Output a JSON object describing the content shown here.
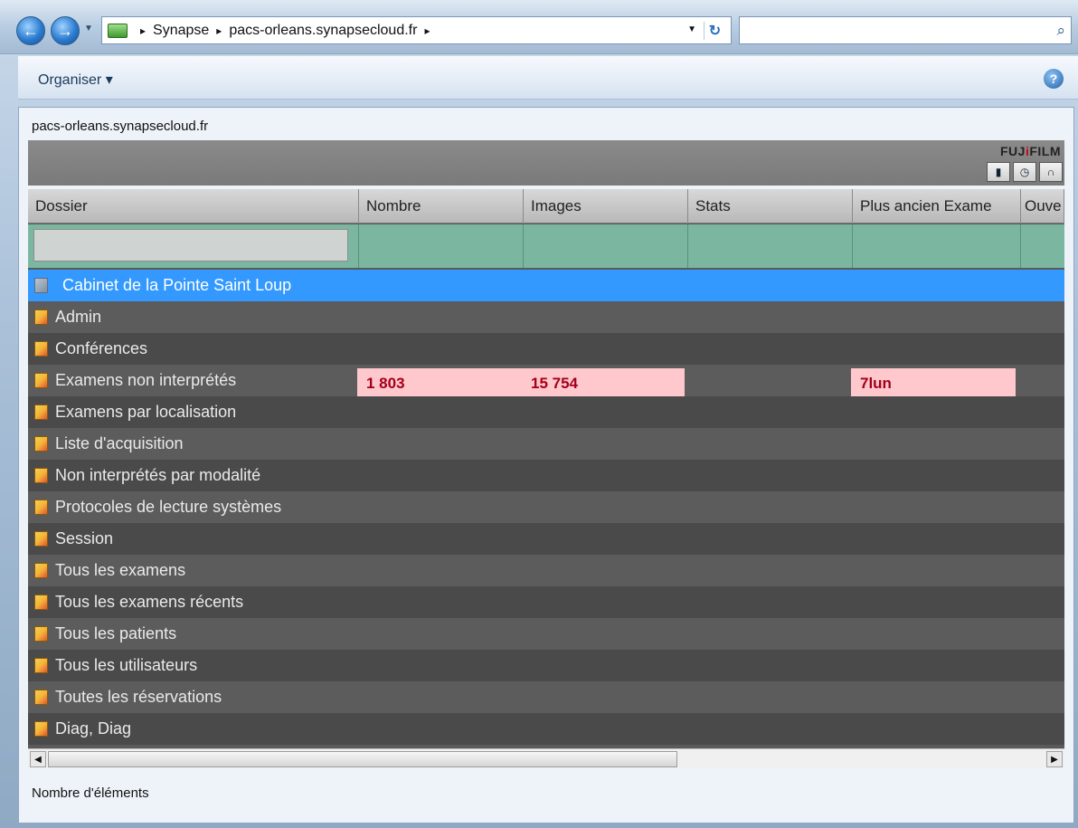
{
  "address_bar": {
    "crumbs": [
      "Synapse",
      "pacs-orleans.synapsecloud.fr"
    ],
    "separator": "▸"
  },
  "toolbar": {
    "organiser_label": "Organiser ▾"
  },
  "site_title": "pacs-orleans.synapsecloud.fr",
  "brand": {
    "logo_prefix": "FUJ",
    "logo_mark": "i",
    "logo_suffix": "FILM"
  },
  "columns": [
    "Dossier",
    "Nombre",
    "Images",
    "Stats",
    "Plus ancien Exame",
    "Ouve"
  ],
  "rows": [
    {
      "name": "Cabinet de la Pointe Saint Loup",
      "selected": true
    },
    {
      "name": "Admin"
    },
    {
      "name": "Conférences"
    },
    {
      "name": "Examens non interprétés",
      "nombre": "1 803",
      "images": "15 754",
      "oldest": "7lun"
    },
    {
      "name": "Examens par localisation"
    },
    {
      "name": "Liste d'acquisition"
    },
    {
      "name": "Non interprétés par modalité"
    },
    {
      "name": "Protocoles de lecture systèmes"
    },
    {
      "name": "Session"
    },
    {
      "name": "Tous les examens"
    },
    {
      "name": "Tous les examens récents"
    },
    {
      "name": "Tous les patients"
    },
    {
      "name": "Tous les utilisateurs"
    },
    {
      "name": "Toutes les réservations"
    },
    {
      "name": "Diag, Diag"
    }
  ],
  "status": "Nombre d'éléments",
  "colors": {
    "selected_row": "#3399ff",
    "highlight_bg": "#ffc8cc",
    "highlight_text": "#a3001a",
    "filter_row": "#7bb7a0"
  }
}
